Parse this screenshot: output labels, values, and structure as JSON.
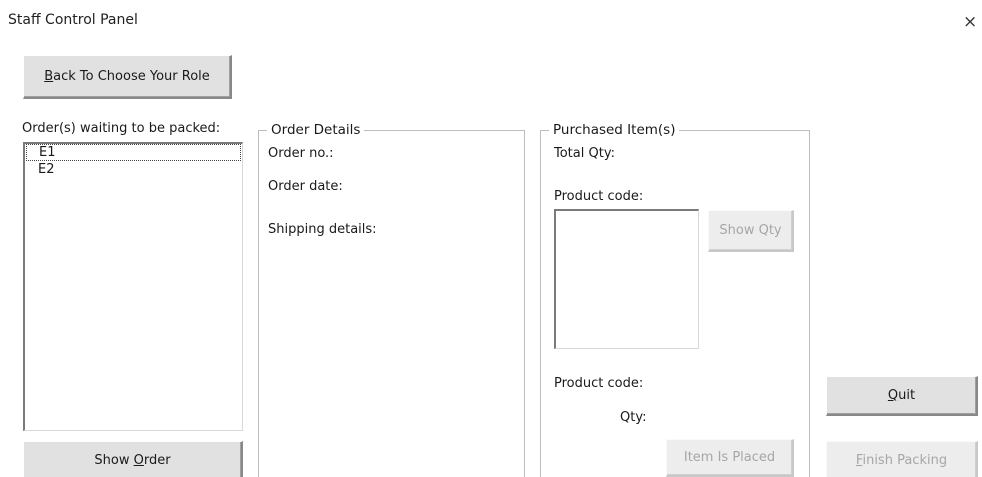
{
  "window": {
    "title": "Staff Control Panel",
    "close_glyph": "×"
  },
  "buttons": {
    "back": {
      "accel": "B",
      "rest": "ack To Choose Your Role"
    },
    "show_order": {
      "pre": "Show ",
      "accel": "O",
      "rest": "rder"
    },
    "show_qty": {
      "label": "Show Qty"
    },
    "quit": {
      "accel": "Q",
      "rest": "uit"
    },
    "item_placed": {
      "label": "Item Is Placed"
    },
    "finish_packing": {
      "accel": "F",
      "rest": "inish Packing"
    }
  },
  "orders_panel": {
    "label": "Order(s) waiting to be packed:",
    "items": [
      "E1",
      "E2"
    ]
  },
  "order_details": {
    "title": "Order Details",
    "order_no_label": "Order no.:",
    "order_date_label": "Order date:",
    "shipping_label": "Shipping details:"
  },
  "purchased_items": {
    "title": "Purchased Item(s)",
    "total_qty_label": "Total Qty:",
    "product_code_label": "Product code:",
    "product_code_label_2": "Product code:",
    "qty_label": "Qty:"
  }
}
